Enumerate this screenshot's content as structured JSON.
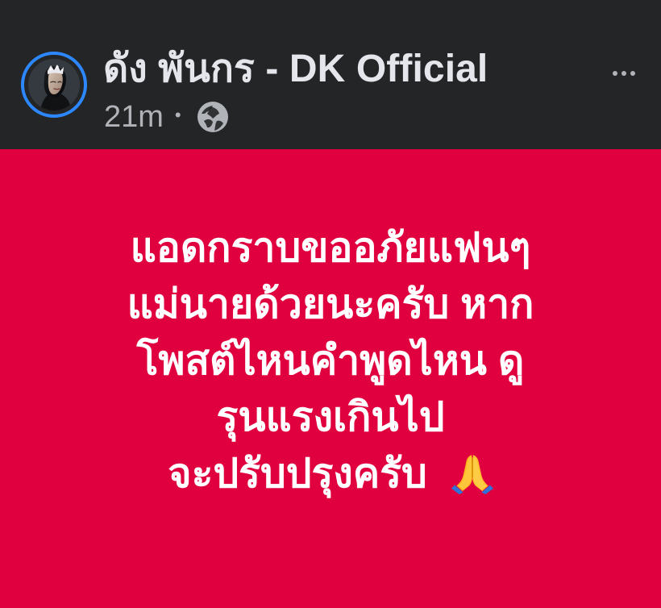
{
  "post": {
    "author": "ดัง พันกร - DK Official",
    "timestamp": "21m",
    "separator": "•",
    "privacy_icon": "globe-icon",
    "more_icon": "more-options-icon"
  },
  "message": {
    "lines": [
      "แอดกราบขออภัยแฟนๆ",
      "แม่นายด้วยนะครับ หาก",
      "โพสต์ไหนคำพูดไหน ดู",
      "รุนแรงเกินไป",
      "จะปรับปรุงครับ"
    ],
    "emoji": "prayer-hands-icon",
    "background": "#e0003f",
    "text_color": "#ffffff"
  },
  "theme": {
    "header_bg": "#242526",
    "name_color": "#e4e6eb",
    "meta_color": "#b0b3b8",
    "avatar_ring": "#2d88ff"
  }
}
